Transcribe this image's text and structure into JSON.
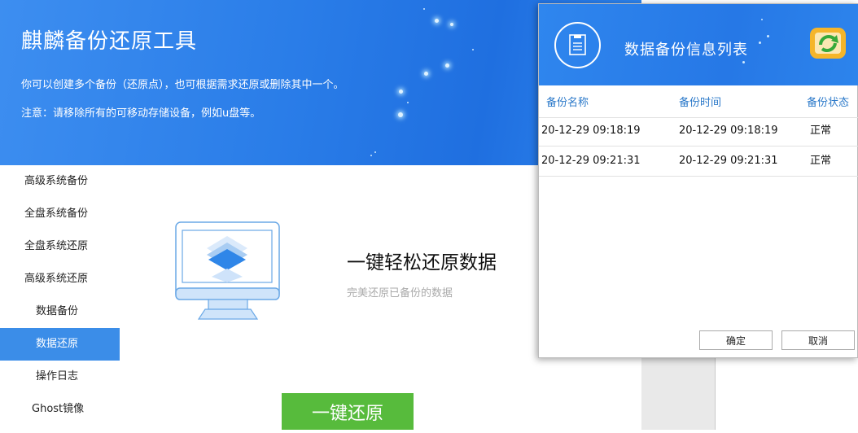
{
  "app": {
    "title": "麒麟备份还原工具",
    "description": "你可以创建多个备份（还原点），也可根据需求还原或删除其中一个。",
    "note": "注意：请移除所有的可移动存储设备，例如u盘等。"
  },
  "sidebar": {
    "items": [
      {
        "label": "高级系统备份",
        "active": false
      },
      {
        "label": "全盘系统备份",
        "active": false
      },
      {
        "label": "全盘系统还原",
        "active": false
      },
      {
        "label": "高级系统还原",
        "active": false
      },
      {
        "label": "数据备份",
        "active": false
      },
      {
        "label": "数据还原",
        "active": true
      },
      {
        "label": "操作日志",
        "active": false
      },
      {
        "label": "Ghost镜像",
        "active": false
      }
    ]
  },
  "main": {
    "hero_title": "一键轻松还原数据",
    "hero_subtitle": "完美还原已备份的数据",
    "restore_button": "一键还原"
  },
  "dialog": {
    "title": "数据备份信息列表",
    "columns": [
      "备份名称",
      "备份时间",
      "备份状态"
    ],
    "rows": [
      {
        "name": "20-12-29 09:18:19",
        "time": "20-12-29 09:18:19",
        "status": "正常"
      },
      {
        "name": "20-12-29 09:21:31",
        "time": "20-12-29 09:21:31",
        "status": "正常"
      }
    ],
    "ok_button": "确定",
    "cancel_button": "取消"
  },
  "colors": {
    "header_blue": "#2a7de8",
    "active_item": "#3b8de8",
    "restore_green": "#57bb3c",
    "column_header_text": "#2a78c9"
  },
  "icons": {
    "dialog_header": "document-icon",
    "dialog_app": "refresh-app-icon",
    "illustration": "monitor-layers-icon"
  }
}
